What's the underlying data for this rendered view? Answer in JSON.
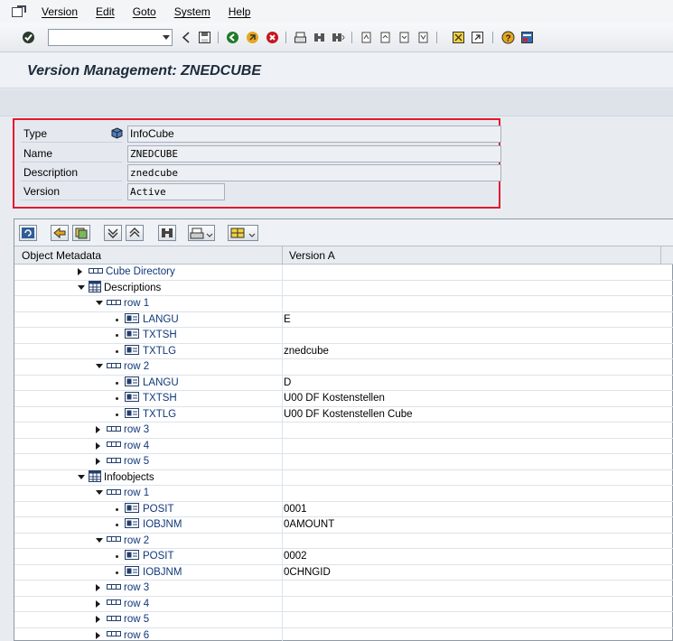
{
  "menu": {
    "items": [
      "Version",
      "Edit",
      "Goto",
      "System",
      "Help"
    ]
  },
  "title": "Version Management: ZNEDCUBE",
  "header": {
    "type_label": "Type",
    "type_value": "InfoCube",
    "name_label": "Name",
    "name_value": "ZNEDCUBE",
    "description_label": "Description",
    "description_value": "znedcube",
    "version_label": "Version",
    "version_value": "Active"
  },
  "tree": {
    "col1_header": "Object Metadata",
    "col2_header": "Version A",
    "rows": [
      {
        "level": 0,
        "expander": "closed",
        "icon": "row",
        "label": "Cube Directory",
        "value": ""
      },
      {
        "level": 0,
        "expander": "open",
        "icon": "table",
        "label": "Descriptions",
        "value": ""
      },
      {
        "level": 1,
        "expander": "open",
        "icon": "row",
        "label": "row 1",
        "value": ""
      },
      {
        "level": 2,
        "expander": "bullet",
        "icon": "field",
        "label": "LANGU",
        "value": "E"
      },
      {
        "level": 2,
        "expander": "bullet",
        "icon": "field",
        "label": "TXTSH",
        "value": ""
      },
      {
        "level": 2,
        "expander": "bullet",
        "icon": "field",
        "label": "TXTLG",
        "value": "znedcube"
      },
      {
        "level": 1,
        "expander": "open",
        "icon": "row",
        "label": "row 2",
        "value": ""
      },
      {
        "level": 2,
        "expander": "bullet",
        "icon": "field",
        "label": "LANGU",
        "value": "D"
      },
      {
        "level": 2,
        "expander": "bullet",
        "icon": "field",
        "label": "TXTSH",
        "value": "U00 DF Kostenstellen"
      },
      {
        "level": 2,
        "expander": "bullet",
        "icon": "field",
        "label": "TXTLG",
        "value": "U00 DF Kostenstellen Cube"
      },
      {
        "level": 1,
        "expander": "closed",
        "icon": "row",
        "label": "row 3",
        "value": ""
      },
      {
        "level": 1,
        "expander": "closed",
        "icon": "row",
        "label": "row 4",
        "value": ""
      },
      {
        "level": 1,
        "expander": "closed",
        "icon": "row",
        "label": "row 5",
        "value": ""
      },
      {
        "level": 0,
        "expander": "open",
        "icon": "table",
        "label": "Infoobjects",
        "value": ""
      },
      {
        "level": 1,
        "expander": "open",
        "icon": "row",
        "label": "row 1",
        "value": ""
      },
      {
        "level": 2,
        "expander": "bullet",
        "icon": "field",
        "label": "POSIT",
        "value": "0001"
      },
      {
        "level": 2,
        "expander": "bullet",
        "icon": "field",
        "label": "IOBJNM",
        "value": "0AMOUNT"
      },
      {
        "level": 1,
        "expander": "open",
        "icon": "row",
        "label": "row 2",
        "value": ""
      },
      {
        "level": 2,
        "expander": "bullet",
        "icon": "field",
        "label": "POSIT",
        "value": "0002"
      },
      {
        "level": 2,
        "expander": "bullet",
        "icon": "field",
        "label": "IOBJNM",
        "value": "0CHNGID"
      },
      {
        "level": 1,
        "expander": "closed",
        "icon": "row",
        "label": "row 3",
        "value": ""
      },
      {
        "level": 1,
        "expander": "closed",
        "icon": "row",
        "label": "row 4",
        "value": ""
      },
      {
        "level": 1,
        "expander": "closed",
        "icon": "row",
        "label": "row 5",
        "value": ""
      },
      {
        "level": 1,
        "expander": "closed",
        "icon": "row",
        "label": "row 6",
        "value": ""
      }
    ]
  },
  "colors": {
    "highlight_border": "#e3182d",
    "node_text": "#10387a"
  }
}
